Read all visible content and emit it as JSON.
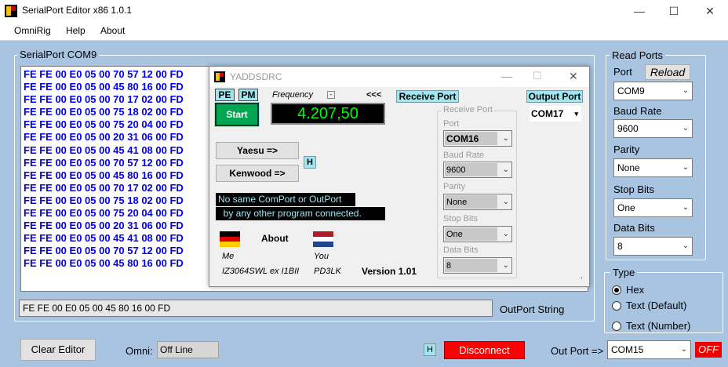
{
  "window": {
    "title": "SerialPort Editor  x86  1.0.1",
    "controls": {
      "minimize": "—",
      "maximize": "☐",
      "close": "✕"
    }
  },
  "menu": {
    "items": [
      "OmniRig",
      "Help",
      "About"
    ]
  },
  "editor": {
    "group_title": "SerialPort COM9",
    "lines": [
      "FE FE 00 E0 05 00 70 57 12 00 FD",
      "FE FE 00 E0 05 00 45 80 16 00 FD",
      "FE FE 00 E0 05 00 70 17 02 00 FD",
      "FE FE 00 E0 05 00 75 18 02 00 FD",
      "FE FE 00 E0 05 00 75 20 04 00 FD",
      "FE FE 00 E0 05 00 20 31 06 00 FD",
      "FE FE 00 E0 05 00 45 41 08 00 FD",
      "FE FE 00 E0 05 00 70 57 12 00 FD",
      "FE FE 00 E0 05 00 45 80 16 00 FD",
      "FE FE 00 E0 05 00 70 17 02 00 FD",
      "FE FE 00 E0 05 00 75 18 02 00 FD",
      "FE FE 00 E0 05 00 75 20 04 00 FD",
      "FE FE 00 E0 05 00 20 31 06 00 FD",
      "FE FE 00 E0 05 00 45 41 08 00 FD",
      "FE FE 00 E0 05 00 70 57 12 00 FD",
      "FE FE 00 E0 05 00 45 80 16 00 FD"
    ]
  },
  "read_ports": {
    "group_title": "Read Ports",
    "port_label": "Port",
    "reload_label": "Reload",
    "port_value": "COM9",
    "baud_label": "Baud Rate",
    "baud_value": "9600",
    "parity_label": "Parity",
    "parity_value": "None",
    "stop_label": "Stop Bits",
    "stop_value": "One",
    "data_label": "Data Bits",
    "data_value": "8"
  },
  "type": {
    "group_title": "Type",
    "options": [
      "Hex",
      "Text (Default)",
      "Text (Number)"
    ],
    "selected": "Hex"
  },
  "outport_string": {
    "value": "FE FE 00 E0 05 00 45 80 16 00 FD",
    "label": "OutPort String"
  },
  "bottom": {
    "clear_label": "Clear Editor",
    "omni_label": "Omni:",
    "omni_value": "Off Line",
    "h_label": "H",
    "disconnect_label": "Disconnect",
    "outport_label": "Out Port =>",
    "outport_value": "COM15",
    "off_label": "OFF"
  },
  "dialog": {
    "title": "YADDSDRC",
    "pe_label": "PE",
    "pm_label": "PM",
    "frequency_label": "Frequency",
    "freq_small_btn": "-",
    "arrows_label": "<<<",
    "start_label": "Start",
    "frequency_value": "4.207,50",
    "receive_port_label": "Receive Port",
    "output_port_label": "Output Port",
    "output_port_value": "COM17",
    "yaesu_label": "Yaesu =>",
    "kenwood_label": "Kenwood =>",
    "h_label": "H",
    "message_line1": "No same ComPort or OutPort",
    "message_line2": "  by any other program connected.",
    "about_label": "About",
    "me_label": "Me",
    "you_label": "You",
    "me_call": "IZ3064SWL ex I1BII",
    "you_call": "PD3LK",
    "version": "Version 1.01",
    "rp_group_title": "Receive Port",
    "rp_port_label": "Port",
    "rp_port_value": "COM16",
    "rp_baud_label": "Baud Rate",
    "rp_baud_value": "9600",
    "rp_parity_label": "Parity",
    "rp_parity_value": "None",
    "rp_stop_label": "Stop Bits",
    "rp_stop_value": "One",
    "rp_data_label": "Data Bits",
    "rp_data_value": "8",
    "dot": "."
  },
  "colors": {
    "background": "#a8c4e0",
    "editor_text": "#0000ee",
    "start_green": "#00a651",
    "lcd_background": "#000000",
    "lcd_text": "#00ff00",
    "cyan_highlight": "#9fe6f0",
    "disconnect_red": "#ff0000",
    "off_red": "#ee0000"
  }
}
